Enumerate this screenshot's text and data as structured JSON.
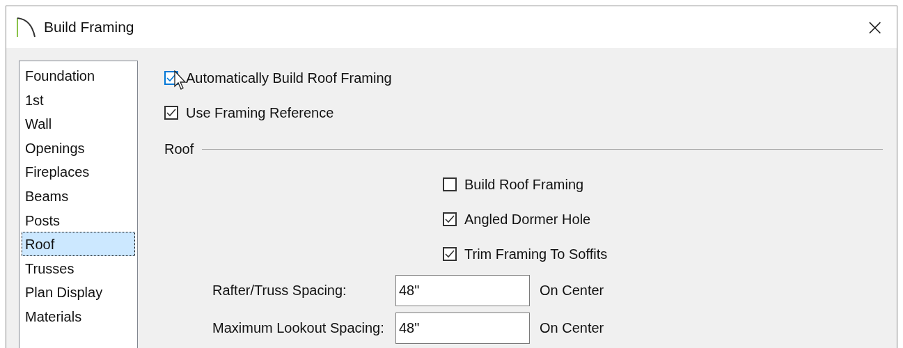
{
  "window": {
    "title": "Build Framing",
    "close": "×"
  },
  "sidebar": {
    "items": [
      {
        "label": "Foundation",
        "selected": false
      },
      {
        "label": "1st",
        "selected": false
      },
      {
        "label": "Wall",
        "selected": false
      },
      {
        "label": "Openings",
        "selected": false
      },
      {
        "label": "Fireplaces",
        "selected": false
      },
      {
        "label": "Beams",
        "selected": false
      },
      {
        "label": "Posts",
        "selected": false
      },
      {
        "label": "Roof",
        "selected": true
      },
      {
        "label": "Trusses",
        "selected": false
      },
      {
        "label": "Plan Display",
        "selected": false
      },
      {
        "label": "Materials",
        "selected": false
      }
    ]
  },
  "options": [
    {
      "label": "Automatically Build Roof Framing",
      "checked": true,
      "hovered": true
    },
    {
      "label": "Use Framing Reference",
      "checked": true,
      "hovered": false
    }
  ],
  "roof": {
    "title": "Roof",
    "options": [
      {
        "label": "Build Roof Framing",
        "checked": false
      },
      {
        "label": "Angled Dormer Hole",
        "checked": true
      },
      {
        "label": "Trim Framing To Soffits",
        "checked": true
      }
    ],
    "fields": [
      {
        "label": "Rafter/Truss Spacing:",
        "value": "48\"",
        "unit": "On Center"
      },
      {
        "label": "Maximum Lookout Spacing:",
        "value": "48\"",
        "unit": "On Center"
      }
    ]
  }
}
